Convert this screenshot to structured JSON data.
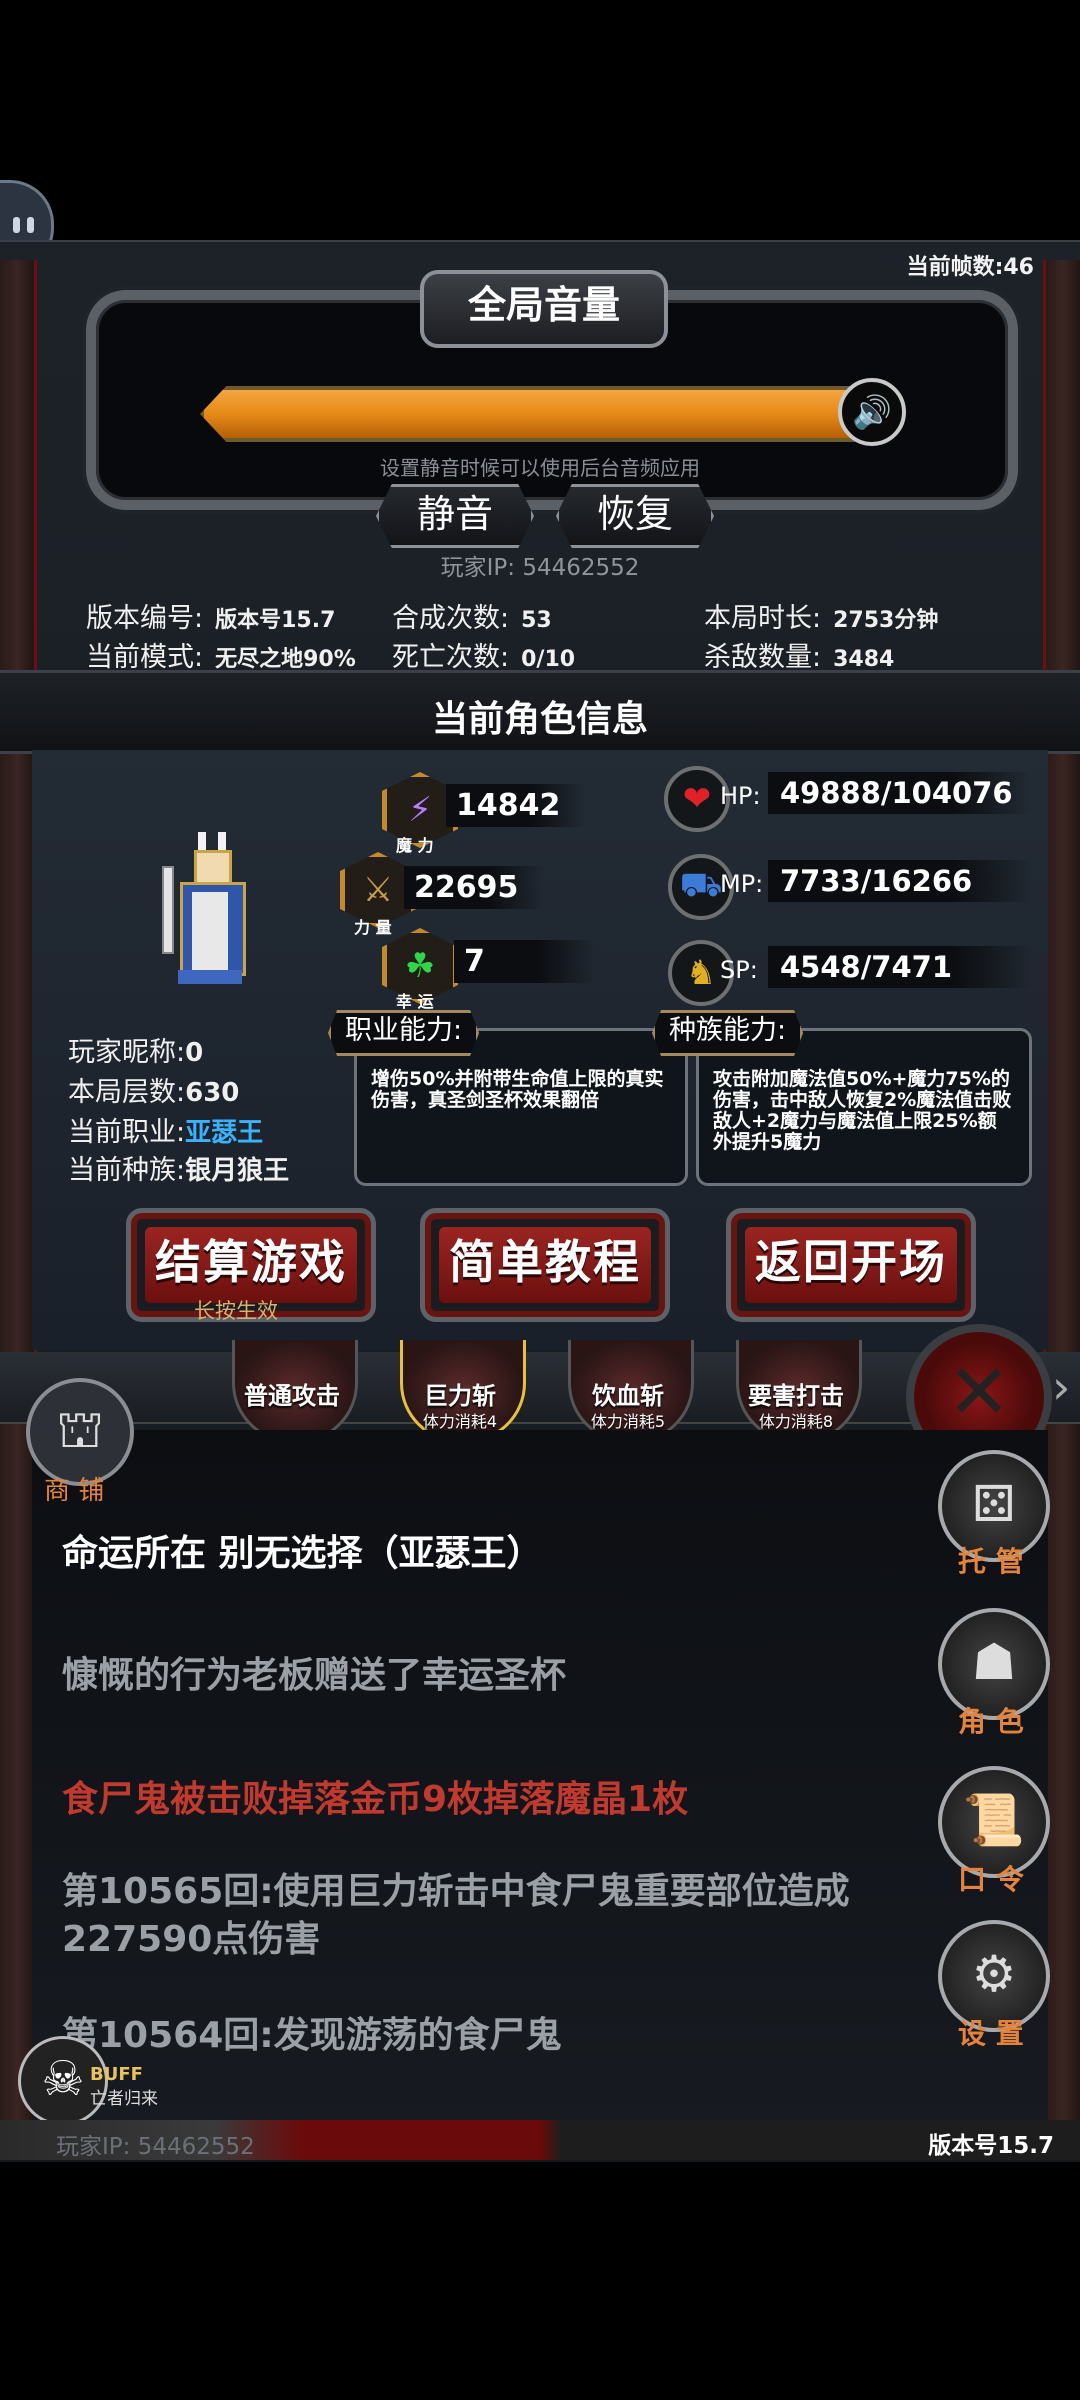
{
  "hud": {
    "fps_label": "当前帧数:46"
  },
  "volume": {
    "title": "全局音量",
    "level_percent": 100,
    "hint": "设置静音时候可以使用后台音频应用",
    "mute_label": "静音",
    "restore_label": "恢复",
    "speaker_icon": "speaker-icon"
  },
  "player_ip_top": "玩家IP:  54462552",
  "game_info": {
    "version_label": "版本编号:",
    "version_value": "版本号15.7",
    "mode_label": "当前模式:",
    "mode_value": "无尽之地90%",
    "craft_label": "合成次数:",
    "craft_value": "53",
    "death_label": "死亡次数:",
    "death_value": "0/10",
    "duration_label": "本局时长:",
    "duration_value": "2753分钟",
    "kills_label": "杀敌数量:",
    "kills_value": "3484"
  },
  "character": {
    "section_title": "当前角色信息",
    "stats": {
      "magic_caption": "魔 力",
      "magic_value": "14842",
      "strength_caption": "力 量",
      "strength_value": "22695",
      "luck_caption": "幸 运",
      "luck_value": "7"
    },
    "resources": {
      "hp_label": "HP:",
      "hp_value": "49888/104076",
      "mp_label": "MP:",
      "mp_value": "7733/16266",
      "sp_label": "SP:",
      "sp_value": "4548/7471"
    },
    "nickname_label": "玩家昵称:",
    "nickname_value": "0",
    "floor_label": "本局层数:",
    "floor_value": "630",
    "class_label": "当前职业:",
    "class_value": "亚瑟王",
    "race_label": "当前种族:",
    "race_value": "银月狼王",
    "class_ability_title": "职业能力:",
    "class_ability_text": "增伤50%并附带生命值上限的真实伤害，真圣剑圣杯效果翻倍",
    "race_ability_title": "种族能力:",
    "race_ability_text": "攻击附加魔法值50%+魔力75%的伤害，击中敌人恢复2%魔法值击败敌人+2魔力与魔法值上限25%额外提升5魔力"
  },
  "actions": {
    "settle_label": "结算游戏",
    "settle_note": "长按生效",
    "tutorial_label": "简单教程",
    "return_label": "返回开场"
  },
  "skills": [
    {
      "name": "普通攻击",
      "cost": ""
    },
    {
      "name": "巨力斩",
      "cost": "体力消耗4"
    },
    {
      "name": "饮血斩",
      "cost": "体力消耗5"
    },
    {
      "name": "要害打击",
      "cost": "体力消耗8"
    }
  ],
  "shop_label": "商 铺",
  "side_menu": {
    "auto_label": "托 管",
    "role_label": "角 色",
    "code_label": "口 令",
    "settings_label": "设 置"
  },
  "log": [
    {
      "text": "命运所在  别无选择（亚瑟王）",
      "color": "#ffffff"
    },
    {
      "text": "慷慨的行为老板赠送了幸运圣杯",
      "color": "#9aa0a6"
    },
    {
      "text": "食尸鬼被击败掉落金币9枚掉落魔晶1枚",
      "color": "#c23a2e"
    },
    {
      "text": "第10565回:使用巨力斩击中食尸鬼重要部位造成227590点伤害",
      "color": "#9aa0a6"
    },
    {
      "text": "第10564回:发现游荡的食尸鬼",
      "color": "#9aa0a6"
    }
  ],
  "buff": {
    "title": "BUFF",
    "subtitle": "亡者归来"
  },
  "footer": {
    "player_ip": "玩家IP:  54462552",
    "version": "版本号15.7"
  }
}
